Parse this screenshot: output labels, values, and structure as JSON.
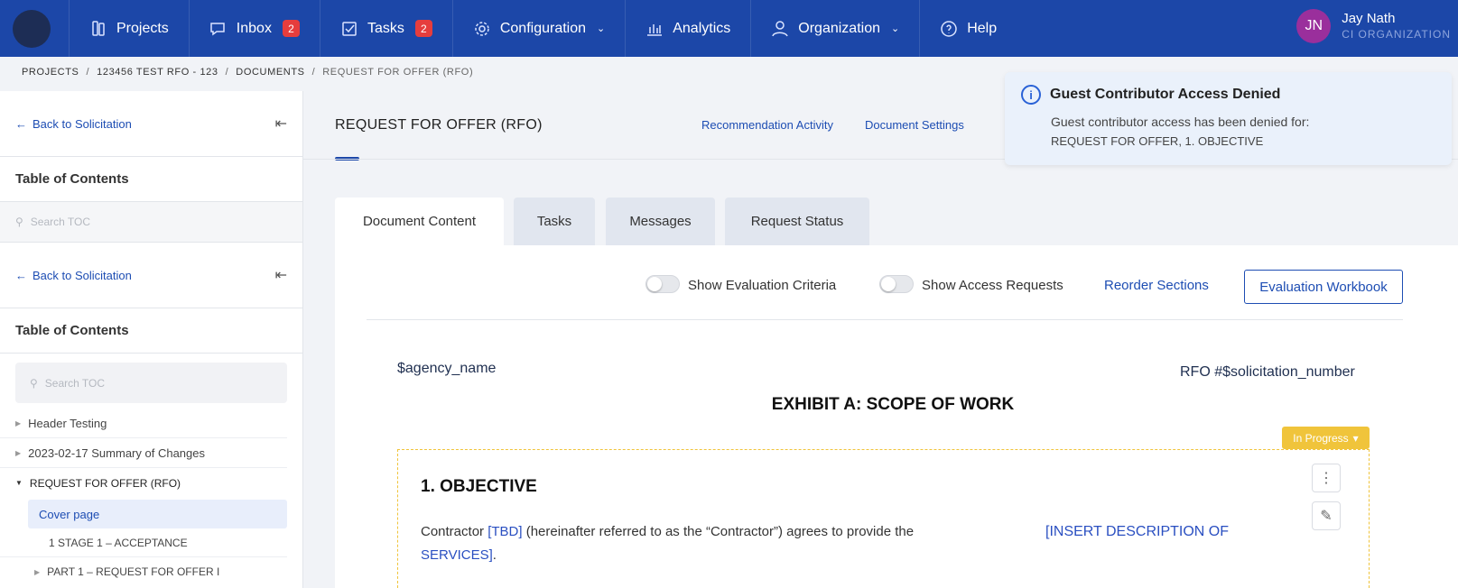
{
  "nav": {
    "items": [
      {
        "label": "Projects",
        "icon": "projects-icon"
      },
      {
        "label": "Inbox",
        "icon": "inbox-icon",
        "badge": "2"
      },
      {
        "label": "Tasks",
        "icon": "tasks-icon",
        "badge": "2"
      },
      {
        "label": "Configuration",
        "icon": "gear-icon"
      },
      {
        "label": "Analytics",
        "icon": "analytics-icon"
      },
      {
        "label": "Organization",
        "icon": "organization-icon"
      },
      {
        "label": "Help",
        "icon": "help-icon"
      }
    ],
    "user": {
      "initials": "JN",
      "name": "Jay Nath",
      "org": "CI ORGANIZATION"
    },
    "colors": {
      "bar": "#1c47a8",
      "avatar": "#9a2f9c",
      "badge": "#e63d3d"
    }
  },
  "breadcrumb": [
    "PROJECTS",
    "123456 TEST RFO - 123",
    "DOCUMENTS",
    "REQUEST FOR OFFER (RFO)"
  ],
  "sidebar": {
    "back_label": "Back to Solicitation",
    "toc_title": "Table of Contents",
    "search_placeholder": "Search TOC",
    "items": [
      "Header Testing",
      "2023-02-17 Summary of Changes",
      "REQUEST FOR OFFER (RFO)"
    ],
    "selected": "Cover page",
    "sub_items": [
      "1 STAGE 1 – ACCEPTANCE",
      "PART 1 – REQUEST FOR OFFER I"
    ]
  },
  "header": {
    "title": "REQUEST FOR OFFER (RFO)",
    "links": [
      "Recommendation Activity",
      "Document Settings"
    ]
  },
  "toast": {
    "title": "Guest Contributor Access Denied",
    "body": "Guest contributor access has been denied for:",
    "detail": "REQUEST FOR OFFER, 1. OBJECTIVE"
  },
  "tabs": [
    "Document Content",
    "Tasks",
    "Messages",
    "Request Status"
  ],
  "toolbar": {
    "show_eval": "Show Evaluation Criteria",
    "show_access": "Show Access Requests",
    "reorder": "Reorder Sections",
    "workbook": "Evaluation Workbook"
  },
  "document": {
    "agency": "$agency_name",
    "rfo_number": "RFO #$solicitation_number",
    "exhibit": "EXHIBIT A: SCOPE OF WORK",
    "status": "In Progress",
    "section_title": "1. OBJECTIVE",
    "body_prefix": "Contractor ",
    "body_tbd": "[TBD]",
    "body_middle": " (hereinafter referred to as the “Contractor”) agrees to provide the",
    "body_insert": "[INSERT DESCRIPTION OF",
    "body_services": "SERVICES]",
    "body_end": "."
  }
}
